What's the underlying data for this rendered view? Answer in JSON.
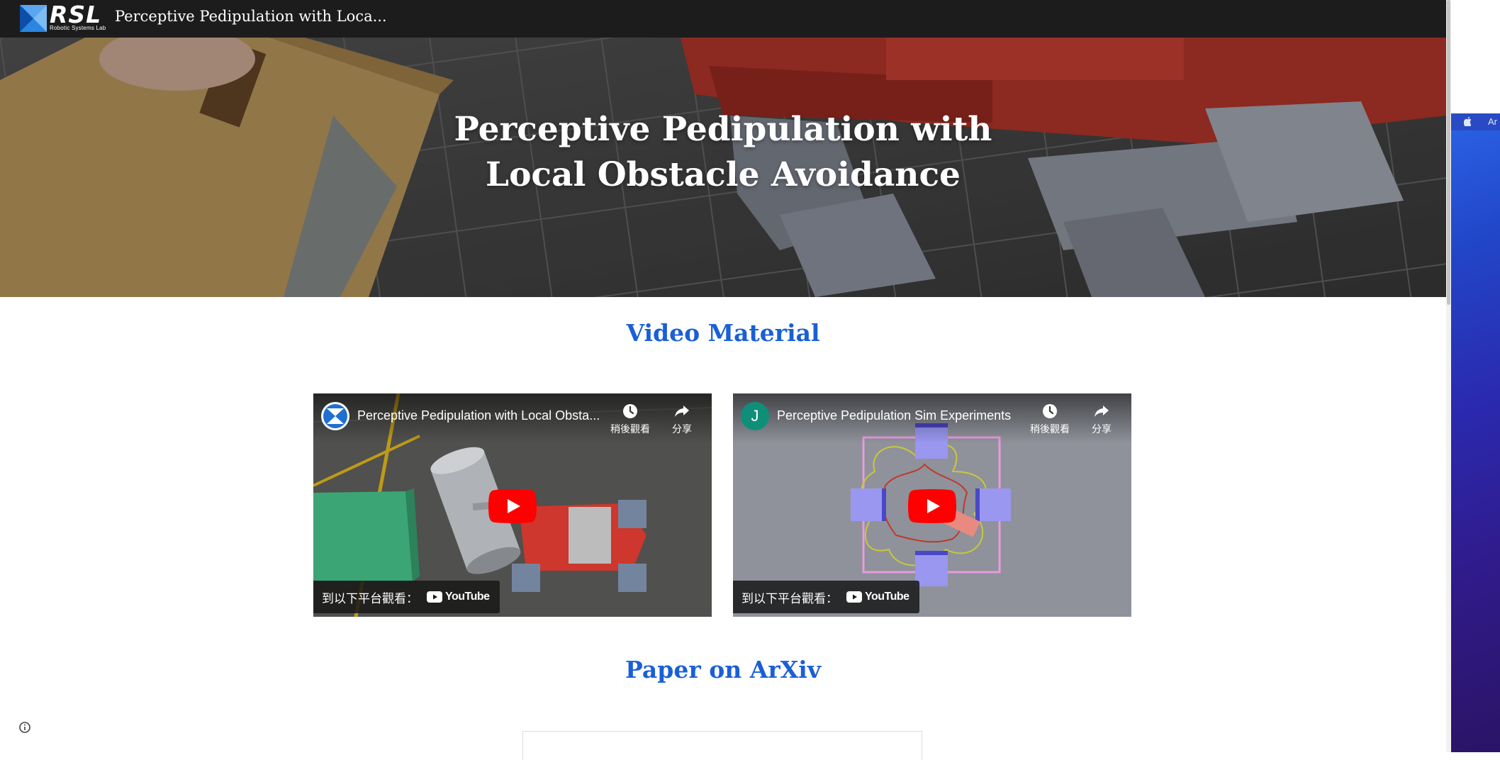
{
  "header": {
    "logo_text": "RSL",
    "logo_subtext": "Robotic Systems Lab",
    "site_title": "Perceptive Pedipulation with Loca..."
  },
  "hero": {
    "title_line1": "Perceptive Pedipulation with",
    "title_line2": "Local Obstacle Avoidance"
  },
  "sections": {
    "video_heading": "Video Material",
    "paper_heading": "Paper on ArXiv"
  },
  "videos": [
    {
      "title": "Perceptive Pedipulation with Local Obsta...",
      "channel_avatar": "rsl-logo",
      "watch_later": "稍後觀看",
      "share": "分享",
      "watch_on": "到以下平台觀看：",
      "platform": "YouTube"
    },
    {
      "title": "Perceptive Pedipulation Sim Experiments",
      "channel_avatar": "J",
      "watch_later": "稍後觀看",
      "share": "分享",
      "watch_on": "到以下平台觀看：",
      "platform": "YouTube"
    }
  ],
  "side_window": {
    "menubar_text": "Ar"
  },
  "colors": {
    "topbar": "#1c1c1c",
    "heading_accent": "#1a5fd6",
    "youtube_red": "#ff0000",
    "avatar_teal": "#0f8f7a"
  },
  "icons": [
    "rsl-logo-icon",
    "clock-icon",
    "share-arrow-icon",
    "play-icon",
    "youtube-icon",
    "info-icon",
    "apple-icon"
  ]
}
